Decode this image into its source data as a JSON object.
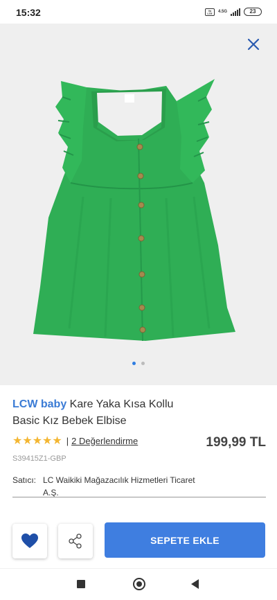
{
  "status_bar": {
    "time": "15:32",
    "volte": "Vo LTE",
    "network": "4.5G",
    "battery": "23"
  },
  "product": {
    "brand": "LCW baby",
    "name": "Kare Yaka Kısa Kollu Basic Kız Bebek Elbise",
    "stars": "★★★★★",
    "rating_value": 5,
    "separator": "|",
    "reviews": "2 Değerlendirme",
    "price": "199,99 TL",
    "sku": "S39415Z1-GBP",
    "seller_label": "Satıcı:",
    "seller_name": "LC Waikiki Mağazacılık Hizmetleri Ticaret A.Ş.",
    "image_colors": {
      "dress": "#2fae55",
      "background": "#efefef"
    }
  },
  "gallery": {
    "page_count": 2,
    "current_page": 1
  },
  "actions": {
    "add_to_cart": "SEPETE EKLE"
  },
  "colors": {
    "brand": "#3a7bd5",
    "button": "#3f7ee0",
    "stars": "#f3b632"
  }
}
